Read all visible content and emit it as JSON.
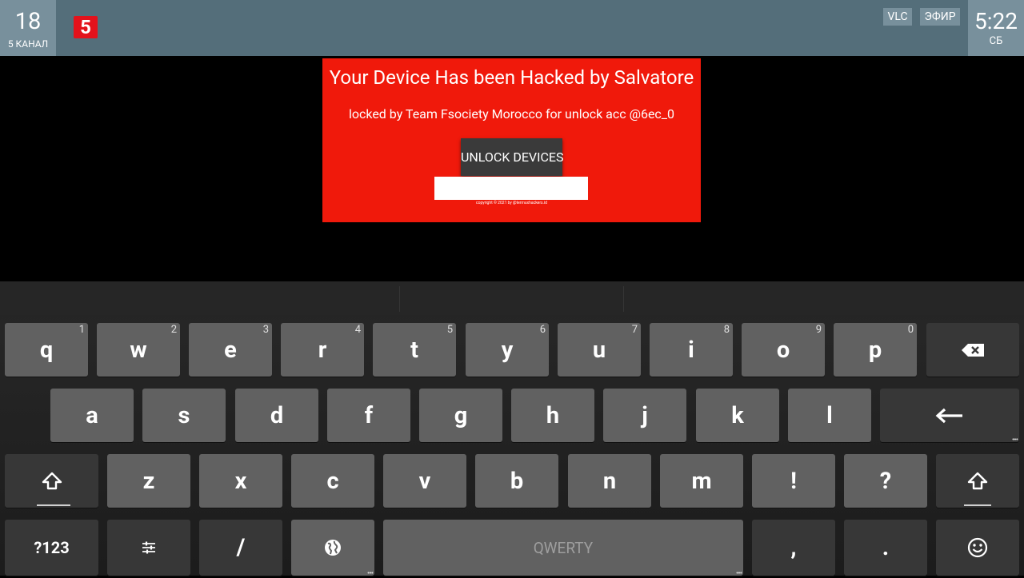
{
  "topbar": {
    "channel_number": "18",
    "channel_name": "5 КАНАЛ",
    "channel_logo": "5",
    "sources": [
      "VLC",
      "ЭФИР"
    ],
    "time": "5:22",
    "day": "СБ"
  },
  "ransom": {
    "title": "Your Device Has been Hacked by Salvatore",
    "message": "locked by Team Fsociety Morocco for unlock acc @6ec_0",
    "button": "UNLOCK DEVICES",
    "input_value": "",
    "copyright": "copyright © 2021 by @termuxhackers.id"
  },
  "keyboard": {
    "row1": [
      {
        "key": "q",
        "hint": "1"
      },
      {
        "key": "w",
        "hint": "2"
      },
      {
        "key": "e",
        "hint": "3"
      },
      {
        "key": "r",
        "hint": "4"
      },
      {
        "key": "t",
        "hint": "5"
      },
      {
        "key": "y",
        "hint": "6"
      },
      {
        "key": "u",
        "hint": "7"
      },
      {
        "key": "i",
        "hint": "8"
      },
      {
        "key": "o",
        "hint": "9"
      },
      {
        "key": "p",
        "hint": "0"
      }
    ],
    "row2": [
      "a",
      "s",
      "d",
      "f",
      "g",
      "h",
      "j",
      "k",
      "l"
    ],
    "row3": [
      "z",
      "x",
      "c",
      "v",
      "b",
      "n",
      "m",
      "!",
      "?"
    ],
    "symbols_label": "?123",
    "slash": "/",
    "space_label": "QWERTY",
    "comma": ",",
    "period": "."
  },
  "colors": {
    "ransom_bg": "#f0190b",
    "topbar_bg": "#546e7a",
    "key_bg": "#616161"
  }
}
